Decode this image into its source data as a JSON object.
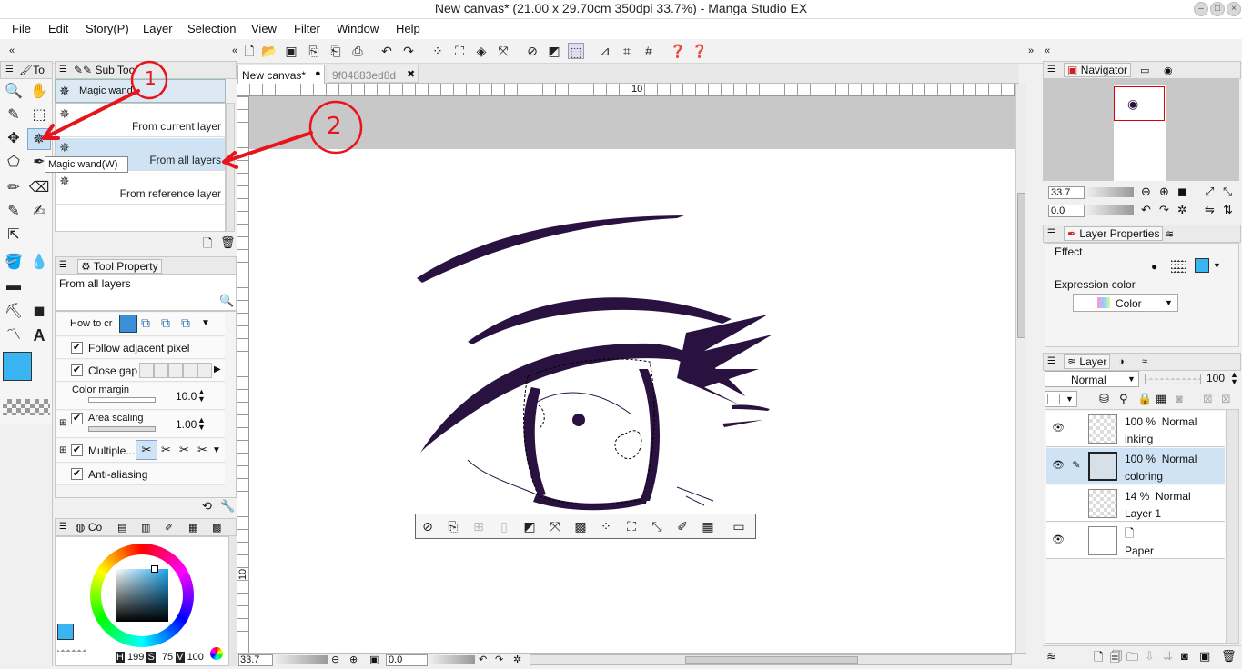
{
  "window": {
    "title": "New canvas* (21.00 x 29.70cm 350dpi 33.7%)  - Manga Studio EX"
  },
  "menu": [
    "File",
    "Edit",
    "Story(P)",
    "Layer",
    "Selection",
    "View",
    "Filter",
    "Window",
    "Help"
  ],
  "tool_panel": {
    "tab_label": "To"
  },
  "sub_tool": {
    "tab_label": "Sub Too",
    "active_tool": "Magic wand",
    "items": [
      "From current layer",
      "From all layers",
      "From reference layer"
    ],
    "tooltip": "Magic wand(W)"
  },
  "tool_property": {
    "tab_label": "Tool Property",
    "current": "From all layers",
    "how_to": "How to cr",
    "follow_adjacent": "Follow adjacent pixel",
    "close_gap": "Close gap",
    "color_margin_label": "Color margin",
    "color_margin_value": "10.0",
    "area_scaling_label": "Area scaling",
    "area_scaling_value": "1.00",
    "multiple_label": "Multiple...",
    "anti_aliasing": "Anti-aliasing"
  },
  "color_panel": {
    "tab_label": "Co",
    "h_label": "H",
    "h_value": "199",
    "s_label": "S",
    "s_value": "75",
    "v_label": "V",
    "v_value": "100",
    "main_color": "#3bb5f2"
  },
  "document_tabs": [
    {
      "label": "New canvas*",
      "active": true
    },
    {
      "label": "9f04883ed8d",
      "active": false
    }
  ],
  "ruler": {
    "top_mark": "10",
    "left_mark": "10"
  },
  "status_bar": {
    "zoom": "33.7",
    "rotation": "0.0"
  },
  "annotations": {
    "first": "1",
    "second": "2"
  },
  "navigator": {
    "tab_label": "Navigator",
    "zoom": "33.7",
    "rotation": "0.0"
  },
  "layer_properties": {
    "tab_label": "Layer Properties",
    "effect_label": "Effect",
    "expression_label": "Expression color",
    "expression_value": "Color"
  },
  "layers_panel": {
    "tab_label": "Layer",
    "blend_mode": "Normal",
    "opacity": "100",
    "layers": [
      {
        "opacity": "100 %",
        "mode": "Normal",
        "name": "inking",
        "visible": true,
        "selected": false
      },
      {
        "opacity": "100 %",
        "mode": "Normal",
        "name": "coloring",
        "visible": true,
        "selected": true
      },
      {
        "opacity": "14 %",
        "mode": "Normal",
        "name": "Layer 1",
        "visible": false,
        "selected": false
      },
      {
        "opacity": "",
        "mode": "",
        "name": "Paper",
        "visible": true,
        "selected": false
      }
    ]
  },
  "colors": {
    "annotation_red": "#e8141c",
    "eye_ink": "#2a1240",
    "selection_blue": "#cfe3f5"
  }
}
